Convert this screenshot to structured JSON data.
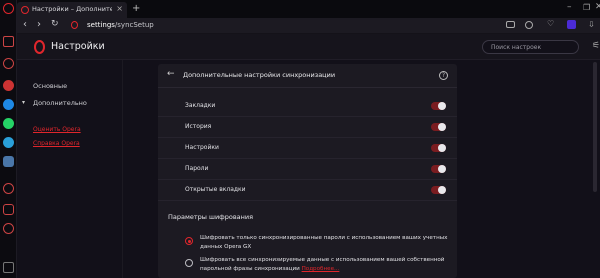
{
  "browser": {
    "tab": {
      "title": "Настройки – Дополнител",
      "close": "×"
    },
    "new_tab": "+",
    "url_host": "settings",
    "url_path": "/syncSetup"
  },
  "settings": {
    "title": "Настройки",
    "search_placeholder": "Поиск настроек",
    "nav": {
      "basic": "Основные",
      "advanced": "Дополнительно",
      "rate_opera": "Оценить Opera",
      "help_opera": "Справка Opera"
    }
  },
  "sync": {
    "panel_title": "Дополнительные настройки синхронизации",
    "help": "?",
    "items": [
      {
        "label": "Закладки",
        "enabled": true
      },
      {
        "label": "История",
        "enabled": true
      },
      {
        "label": "Настройки",
        "enabled": true
      },
      {
        "label": "Пароли",
        "enabled": true
      },
      {
        "label": "Открытые вкладки",
        "enabled": true
      }
    ],
    "encryption_title": "Параметры шифрования",
    "option1": "Шифровать только синхронизированные пароли с использованием ваших учетных данных Opera GX",
    "option2": "Шифровать все синхронизируемые данные с использованием вашей собственной парольной фразы синхронизации",
    "option2_more": "Подробнее...",
    "selected_option": 1
  },
  "colors": {
    "accent": "#e0262c",
    "background": "#121019",
    "panel": "#1c1a22"
  }
}
